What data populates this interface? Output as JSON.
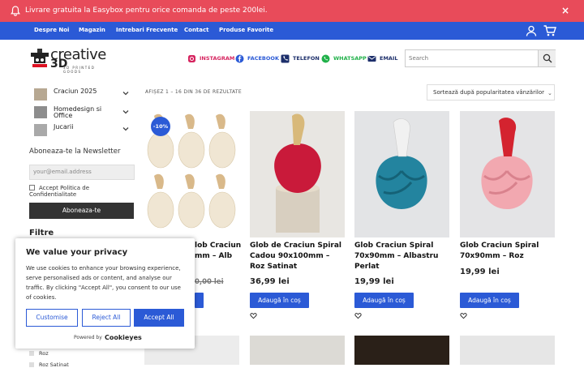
{
  "promo": {
    "text": "Livrare gratuita la Easybox pentru orice comanda de peste 200lei.",
    "close": "×"
  },
  "nav": {
    "items": [
      "Despre Noi",
      "Magazin",
      "Intrebari Frecvente",
      "Contact",
      "Produse Favorite"
    ]
  },
  "logo": {
    "word": "creative",
    "mark": "3D",
    "sub": "3D PRINTED GOODS"
  },
  "social": [
    {
      "label": "INSTAGRAM",
      "icon": "instagram-icon",
      "color": "#d6245f"
    },
    {
      "label": "FACEBOOK",
      "icon": "facebook-icon",
      "color": "#2b5ad6"
    },
    {
      "label": "TELEFON",
      "icon": "phone-icon",
      "color": "#1d2f6b"
    },
    {
      "label": "WHATSAPP",
      "icon": "whatsapp-icon",
      "color": "#21b14a"
    },
    {
      "label": "EMAIL",
      "icon": "email-icon",
      "color": "#1d2f6b"
    }
  ],
  "search": {
    "placeholder": "Search"
  },
  "categories": [
    {
      "label": "Craciun 2025"
    },
    {
      "label": "Homedesign si Office"
    },
    {
      "label": "Jucarii"
    }
  ],
  "newsletter": {
    "title": "Aboneaza-te la Newsletter",
    "placeholder": "your@email.address",
    "consent": "Accept Politica de Confidentialitate",
    "button": "Aboneaza-te"
  },
  "filters": {
    "title": "Filtre",
    "options": [
      "Roz",
      "Roz Satinat"
    ]
  },
  "listing": {
    "showing": "AFIȘEZ 1 – 16 DIN 36 DE REZULTATE",
    "sort": "Sortează după popularitatea vânzărilor"
  },
  "products": [
    {
      "title_visible": "lob Craciun",
      "title_line2": "mm – Alb",
      "old_price": "0,00 lei",
      "badge": "-10%",
      "add": "Adaugă în coș"
    },
    {
      "title": "Glob de Craciun Spiral Cadou 90x100mm – Roz Satinat",
      "price": "36,99 lei",
      "add": "Adaugă în coș"
    },
    {
      "title": "Glob Craciun Spiral 70x90mm – Albastru Perlat",
      "price": "19,99 lei",
      "add": "Adaugă în coș"
    },
    {
      "title": "Glob Craciun Spiral 70x90mm – Roz",
      "price": "19,99 lei",
      "add": "Adaugă în coș"
    }
  ],
  "cookie": {
    "title": "We value your privacy",
    "body": "We use cookies to enhance your browsing experience, serve personalised ads or content, and analyse our traffic. By clicking \"Accept All\", you consent to our use of cookies.",
    "customise": "Customise",
    "reject": "Reject All",
    "accept": "Accept All",
    "powered": "Powered by",
    "brand": "Cookieyes"
  },
  "colors": {
    "accent": "#2b5ad6",
    "promo": "#e84b5a"
  }
}
